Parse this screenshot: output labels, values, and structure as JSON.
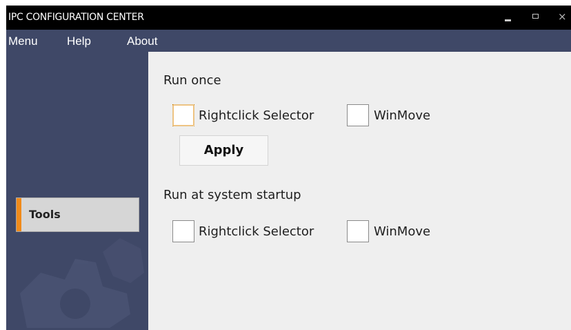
{
  "window": {
    "title": "IPC CONFIGURATION CENTER",
    "controls": {
      "minimize": "minimize-icon",
      "maximize": "maximize-icon",
      "close": "×"
    }
  },
  "menubar": {
    "items": [
      "Menu",
      "Help",
      "About"
    ]
  },
  "sidebar": {
    "items": [
      {
        "label": "Tools",
        "selected": true
      }
    ],
    "accent_color": "#f08a1a",
    "background_color": "#3f4867"
  },
  "run_once": {
    "title": "Run once",
    "options": [
      {
        "label": "Rightclick Selector",
        "checked": false,
        "focused": true
      },
      {
        "label": "WinMove",
        "checked": false
      }
    ],
    "apply_label": "Apply"
  },
  "startup": {
    "title": "Run at system startup",
    "options": [
      {
        "label": "Rightclick Selector",
        "checked": false
      },
      {
        "label": "WinMove",
        "checked": false
      }
    ]
  }
}
